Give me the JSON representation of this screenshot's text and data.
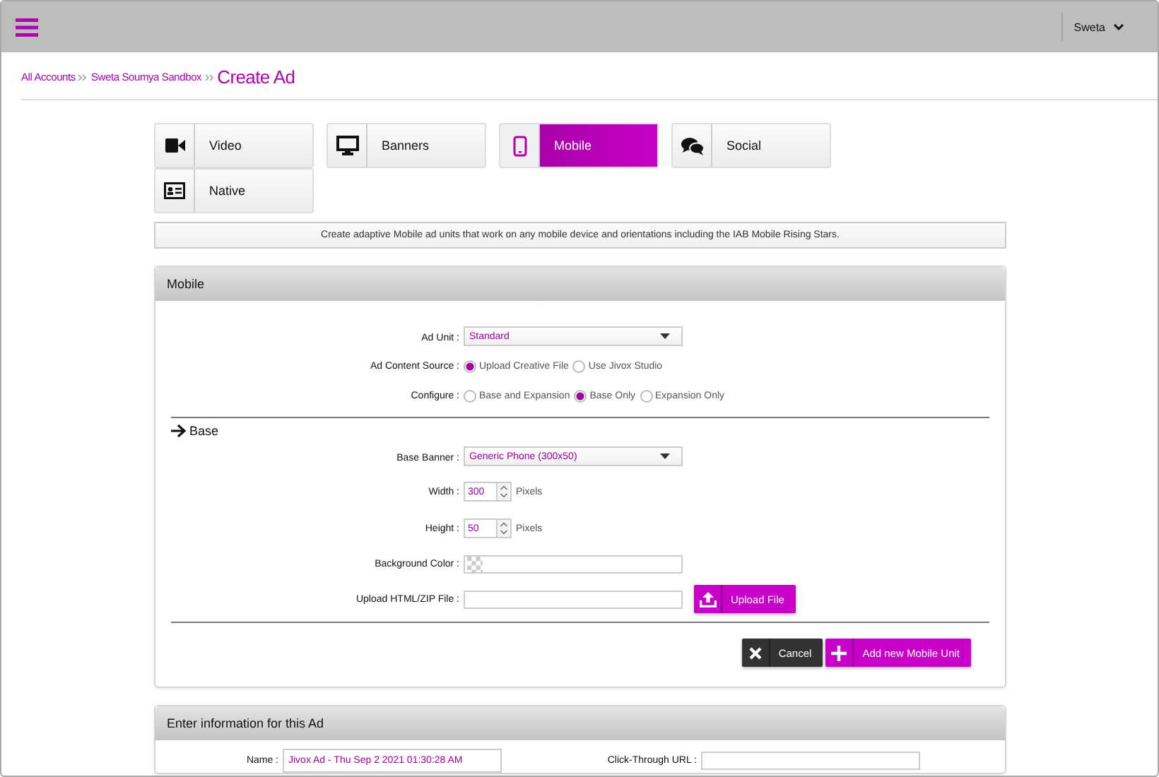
{
  "user_menu": {
    "label": "Sweta"
  },
  "breadcrumb": [
    {
      "label": "All Accounts"
    },
    {
      "label": "Sweta Soumya Sandbox"
    }
  ],
  "page_title": "Create Ad",
  "tabs": [
    {
      "label": "Video",
      "kind": "video",
      "selected": false
    },
    {
      "label": "Banners",
      "kind": "banners",
      "selected": false
    },
    {
      "label": "Mobile",
      "kind": "mobile",
      "selected": true
    },
    {
      "label": "Social",
      "kind": "social",
      "selected": false
    },
    {
      "label": "Native",
      "kind": "native",
      "selected": false
    }
  ],
  "description": "Create adaptive Mobile ad units that work on any mobile device and orientations including the IAB Mobile Rising Stars.",
  "mobile_panel": {
    "title": "Mobile",
    "fields": [
      {
        "kind": "select",
        "label": "Ad Unit :",
        "value": "Standard"
      },
      {
        "kind": "radio",
        "label": "Ad Content Source :",
        "options": [
          {
            "label": "Upload Creative File",
            "selected": true
          },
          {
            "label": "Use Jivox Studio",
            "selected": false
          }
        ]
      },
      {
        "kind": "radio",
        "label": "Configure :",
        "options": [
          {
            "label": "Base and Expansion",
            "selected": false
          },
          {
            "label": "Base Only",
            "selected": true
          },
          {
            "label": "Expansion Only",
            "selected": false
          }
        ]
      },
      {
        "kind": "rule"
      },
      {
        "kind": "section",
        "label": "Base"
      },
      {
        "kind": "select",
        "label": "Base Banner :",
        "value": "Generic Phone (300x50)"
      },
      {
        "kind": "spinner",
        "label": "Width :",
        "value": "300",
        "unit": "Pixels"
      },
      {
        "kind": "spinner",
        "label": "Height :",
        "value": "50",
        "unit": "Pixels"
      },
      {
        "kind": "color",
        "label": "Background Color :"
      },
      {
        "kind": "file",
        "label": "Upload HTML/ZIP File :",
        "button": "Upload File"
      },
      {
        "kind": "rule"
      }
    ],
    "buttons": [
      {
        "kind": "cancel",
        "label": "Cancel"
      },
      {
        "kind": "add",
        "label": "Add new Mobile Unit"
      }
    ]
  },
  "info_panel": {
    "title": "Enter information for this Ad",
    "fields": [
      {
        "label": "Name :",
        "value": "Jivox Ad - Thu Sep 2 2021 01:30:28 AM"
      },
      {
        "label": "Click-Through URL :"
      }
    ]
  }
}
